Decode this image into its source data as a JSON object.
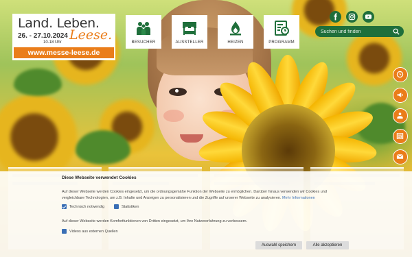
{
  "logo": {
    "title_line": "Land. Leben.",
    "title_script": "Leese.",
    "dates": "26. - 27.10.2024",
    "time": "10-18 Uhr",
    "url": "www.messe-leese.de"
  },
  "nav": [
    {
      "label": "BESUCHER",
      "icon": "visitors-icon"
    },
    {
      "label": "AUSSTELLER",
      "icon": "market-stall-icon"
    },
    {
      "label": "HEIZEN",
      "icon": "flame-drop-icon"
    },
    {
      "label": "PROGRAMM",
      "icon": "schedule-icon"
    }
  ],
  "social": [
    "facebook-icon",
    "instagram-icon",
    "youtube-icon"
  ],
  "search": {
    "placeholder": "Suchen und finden"
  },
  "side_buttons": [
    "clock-icon",
    "megaphone-icon",
    "ticket-person-icon",
    "newspaper-icon",
    "mail-icon"
  ],
  "colors": {
    "brand_green": "#1f6f3b",
    "accent_orange": "#ea7d1a",
    "link_blue": "#3a6fb5"
  },
  "cookie": {
    "title": "Diese Webseite verwendet Cookies",
    "text": "Auf dieser Webseite werden Cookies eingesetzt, um die ordnungsgemäße Funktion der Webseite zu ermöglichen. Darüber hinaus verwenden wir Cookies und vergleichbare Technologien, um z.B. Inhalte und Anzeigen zu personalisieren und die Zugriffe auf unserer Webseite zu analysieren.",
    "more_link": "Mehr Informationen",
    "checks_top": [
      {
        "label": "Technisch notwendig",
        "checked": true
      },
      {
        "label": "Statistiken",
        "checked": false
      }
    ],
    "comfort_text": "Auf dieser Webseite werden Komfortfunktionen von Dritten eingesetzt, um Ihre Nutzererfahrung zu verbessern.",
    "check_bottom": {
      "label": "Videos aus externen Quellen",
      "checked": false
    },
    "save_label": "Auswahl speichern",
    "accept_label": "Alle akzeptieren"
  }
}
